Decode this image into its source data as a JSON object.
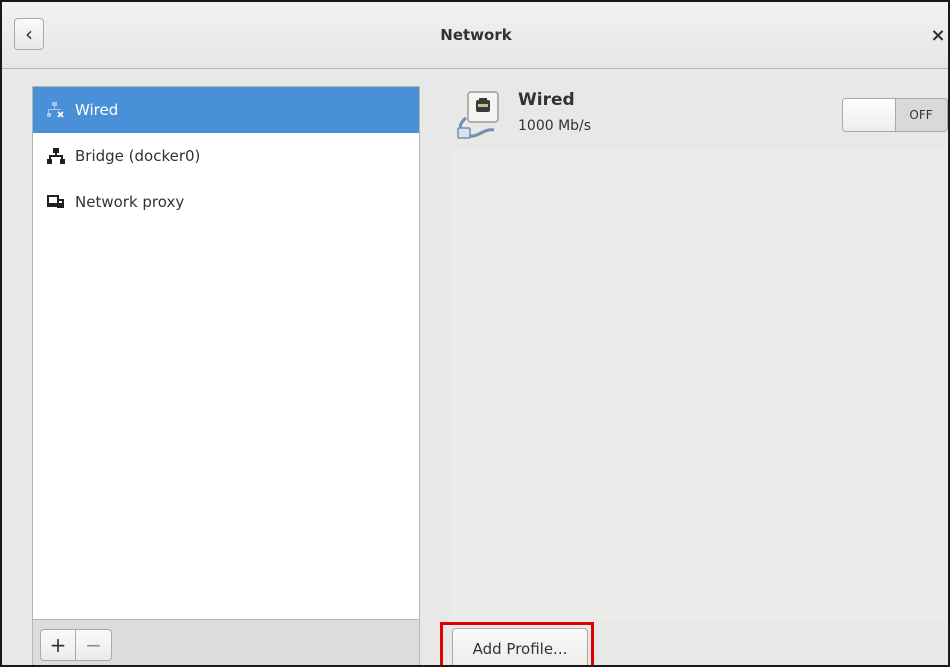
{
  "window": {
    "title": "Network",
    "back_label": "‹",
    "close_label": "×"
  },
  "sidebar": {
    "items": [
      {
        "label": "Wired",
        "icon": "network-wired-disconnected-icon",
        "selected": true
      },
      {
        "label": "Bridge (docker0)",
        "icon": "network-bridge-icon",
        "selected": false
      },
      {
        "label": "Network proxy",
        "icon": "network-proxy-icon",
        "selected": false
      }
    ],
    "add_label": "+",
    "remove_label": "−"
  },
  "device": {
    "name": "Wired",
    "speed": "1000 Mb/s",
    "icon": "ethernet-cable-icon",
    "switch_state": "OFF"
  },
  "actions": {
    "add_profile_label": "Add Profile..."
  },
  "colors": {
    "selection": "#4a90d9",
    "highlight": "#e00000"
  }
}
